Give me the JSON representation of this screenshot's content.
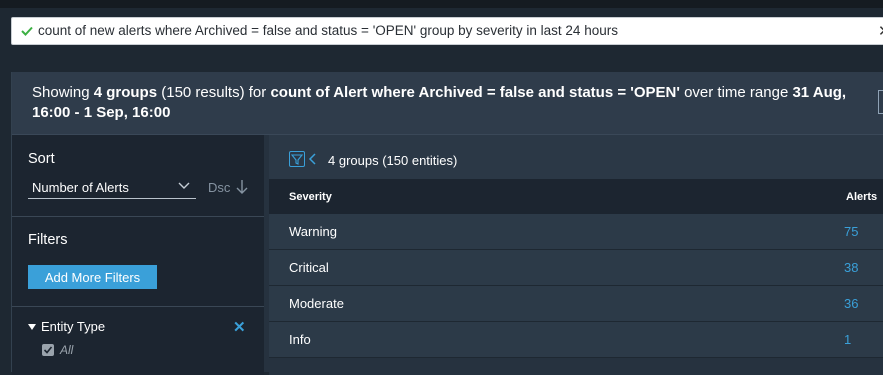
{
  "query": {
    "text": "count of new alerts where Archived = false and status = 'OPEN' group by severity in last 24 hours",
    "status_color": "#3cb043",
    "close_icon": "close-icon"
  },
  "summary": {
    "prefix": "Showing ",
    "groups": "4 groups",
    "results": " (150 results) for ",
    "count_of": "count of Alert where Archived = false and status = 'OPEN'",
    "over": " over time range ",
    "range": "31 Aug, 16:00 - 1 Sep, 16:00"
  },
  "sidebar": {
    "sort_title": "Sort",
    "sort_value": "Number of Alerts",
    "sort_direction": "Dsc",
    "filters_title": "Filters",
    "add_filters_label": "Add More Filters",
    "entity_type_label": "Entity Type",
    "entity_all_label": "All"
  },
  "content": {
    "groups_summary": "4 groups (150 entities)",
    "columns": {
      "severity": "Severity",
      "alerts": "Alerts"
    },
    "rows": [
      {
        "severity": "Warning",
        "alerts": "75"
      },
      {
        "severity": "Critical",
        "alerts": "38"
      },
      {
        "severity": "Moderate",
        "alerts": "36"
      },
      {
        "severity": "Info",
        "alerts": "1"
      }
    ]
  },
  "colors": {
    "accent": "#3aa0d9",
    "background": "#1e2832",
    "panel": "#26323f"
  }
}
